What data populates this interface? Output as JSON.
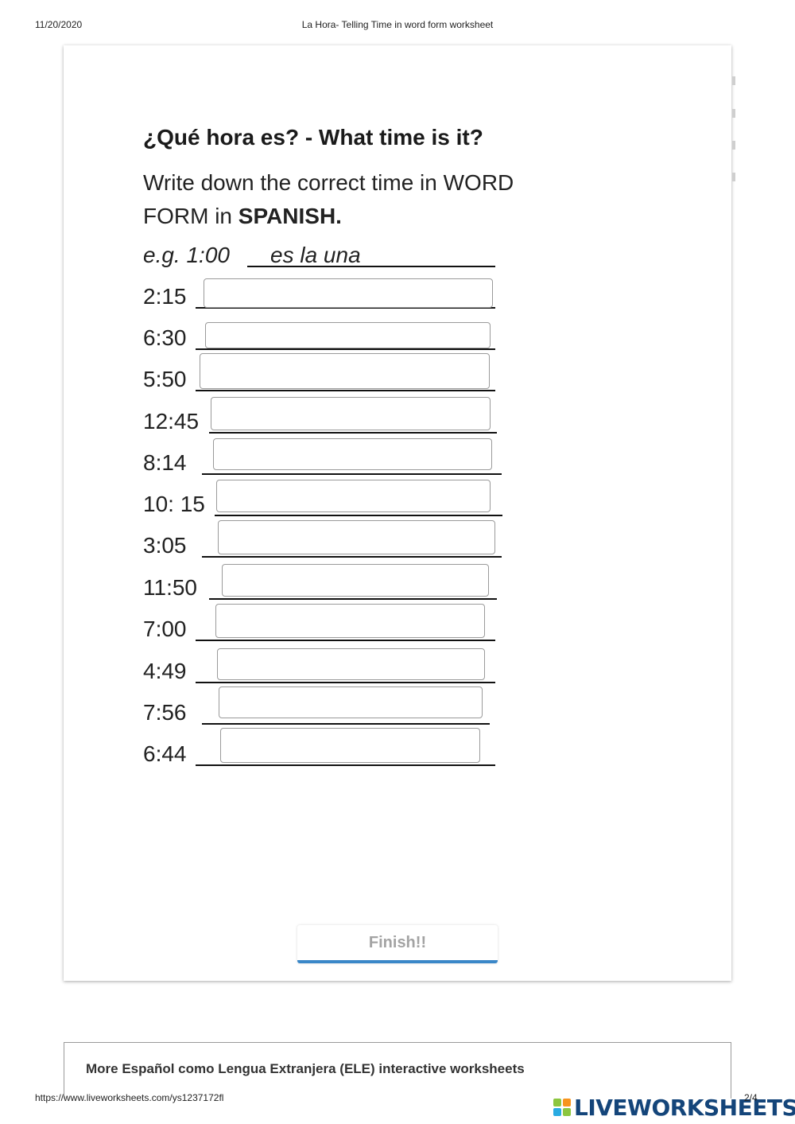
{
  "print_header": {
    "date": "11/20/2020",
    "title": "La Hora- Telling Time in word form worksheet"
  },
  "worksheet": {
    "heading": "¿Qué hora es? - What time is it?",
    "instruction_line1": "Write down the correct time in WORD",
    "instruction_line2_prefix": "FORM in ",
    "instruction_line2_bold": "SPANISH.",
    "example_label": "e.g. 1:00",
    "example_answer": "es la una",
    "rows": [
      {
        "time": "2:15",
        "value": ""
      },
      {
        "time": "6:30",
        "value": ""
      },
      {
        "time": "5:50",
        "value": ""
      },
      {
        "time": "12:45",
        "value": ""
      },
      {
        "time": "8:14",
        "value": ""
      },
      {
        "time": "10: 15",
        "value": ""
      },
      {
        "time": "3:05",
        "value": ""
      },
      {
        "time": "11:50",
        "value": ""
      },
      {
        "time": "7:00",
        "value": ""
      },
      {
        "time": "4:49",
        "value": ""
      },
      {
        "time": "7:56",
        "value": ""
      },
      {
        "time": "6:44",
        "value": ""
      }
    ]
  },
  "finish_button": "Finish!!",
  "more_worksheets": "More Español como Lengua Extranjera (ELE) interactive worksheets",
  "footer": {
    "url": "https://www.liveworksheets.com/ys1237172fl",
    "page": "2/4",
    "brand": "LIVEWORKSHEETS"
  },
  "colors": {
    "accent_blue": "#3a87c8",
    "brand_navy": "#14457a",
    "logo_green": "#8cc63f",
    "logo_orange": "#f7941d",
    "logo_blue": "#29abe2"
  }
}
